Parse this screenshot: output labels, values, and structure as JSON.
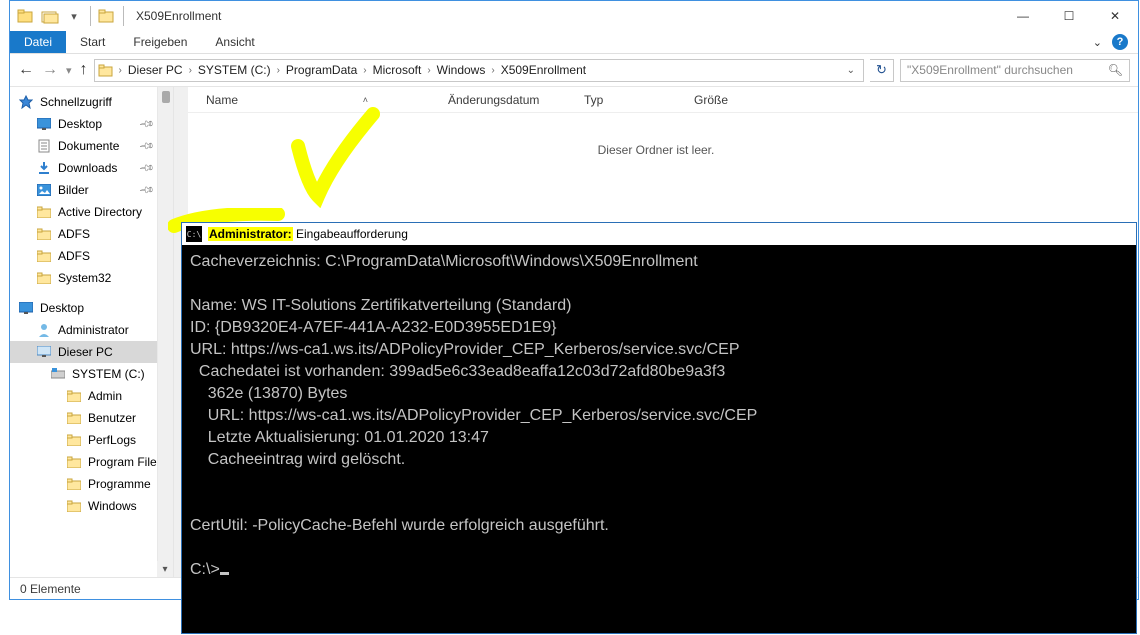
{
  "window": {
    "title": "X509Enrollment",
    "controls": {
      "min": "—",
      "max": "☐",
      "close": "✕"
    }
  },
  "menu": {
    "file": "Datei",
    "start": "Start",
    "share": "Freigeben",
    "view": "Ansicht"
  },
  "breadcrumbs": [
    "Dieser PC",
    "SYSTEM (C:)",
    "ProgramData",
    "Microsoft",
    "Windows",
    "X509Enrollment"
  ],
  "search": {
    "placeholder": "\"X509Enrollment\" durchsuchen"
  },
  "columns": {
    "name": "Name",
    "date": "Änderungsdatum",
    "type": "Typ",
    "size": "Größe"
  },
  "empty_message": "Dieser Ordner ist leer.",
  "status": "0 Elemente",
  "tree": {
    "quick": "Schnellzugriff",
    "desktop": "Desktop",
    "documents": "Dokumente",
    "downloads": "Downloads",
    "pictures": "Bilder",
    "ad": "Active Directory",
    "adfs1": "ADFS",
    "adfs2": "ADFS",
    "sys32": "System32",
    "desktop2": "Desktop",
    "admin": "Administrator",
    "thispc": "Dieser PC",
    "drive": "SYSTEM (C:)",
    "f_admin": "Admin",
    "f_users": "Benutzer",
    "f_perf": "PerfLogs",
    "f_progfiles": "Program Files",
    "f_programs": "Programme",
    "f_windows": "Windows"
  },
  "cmd": {
    "title_prefix": "Administrator:",
    "title_rest": " Eingabeaufforderung",
    "lines": [
      "Cacheverzeichnis: C:\\ProgramData\\Microsoft\\Windows\\X509Enrollment",
      "",
      "Name: WS IT-Solutions Zertifikatverteilung (Standard)",
      "ID: {DB9320E4-A7EF-441A-A232-E0D3955ED1E9}",
      "URL: https://ws-ca1.ws.its/ADPolicyProvider_CEP_Kerberos/service.svc/CEP",
      "  Cachedatei ist vorhanden: 399ad5e6c33ead8eaffa12c03d72afd80be9a3f3",
      "    362e (13870) Bytes",
      "    URL: https://ws-ca1.ws.its/ADPolicyProvider_CEP_Kerberos/service.svc/CEP",
      "    Letzte Aktualisierung: 01.01.2020 13:47",
      "    Cacheeintrag wird gelöscht.",
      "",
      "",
      "CertUtil: -PolicyCache-Befehl wurde erfolgreich ausgeführt.",
      "",
      "C:\\>"
    ]
  }
}
